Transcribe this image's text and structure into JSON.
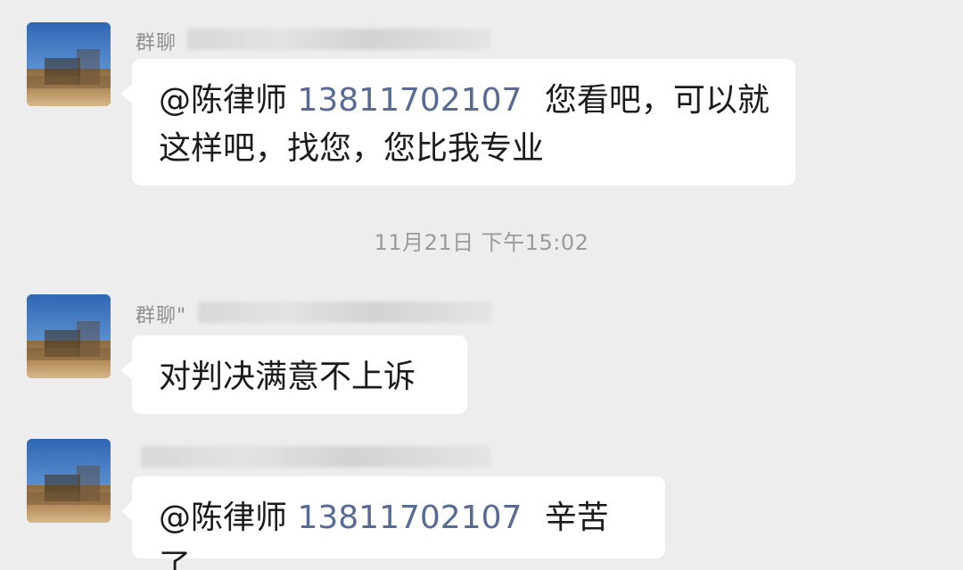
{
  "messages": [
    {
      "sender_visible": "群聊",
      "mention": "@陈律师",
      "phone": "13811702107",
      "line1_rest": "您看吧，可以就",
      "line2": "这样吧，找您，您比我专业"
    },
    {
      "sender_visible": "群聊\"",
      "text": "对判决满意不上诉"
    },
    {
      "sender_visible": "",
      "mention": "@陈律师",
      "phone": "13811702107",
      "rest": "辛苦了"
    }
  ],
  "timestamp": "11月21日 下午15:02",
  "colors": {
    "background": "#ededed",
    "bubble": "#ffffff",
    "link_blue": "#576b95",
    "timestamp_gray": "#9a9a9a"
  }
}
